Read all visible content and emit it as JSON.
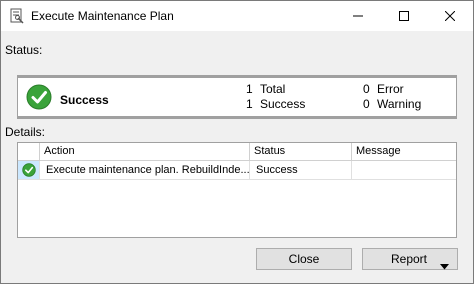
{
  "window": {
    "title": "Execute Maintenance Plan",
    "icon": "maintenance-plan-icon",
    "controls": [
      "minimize-icon",
      "maximize-icon",
      "close-icon"
    ]
  },
  "status": {
    "label": "Status:",
    "result": "Success",
    "result_icon": "check-icon",
    "stats": [
      {
        "count": "1",
        "label": "Total"
      },
      {
        "count": "1",
        "label": "Success"
      },
      {
        "count": "0",
        "label": "Error"
      },
      {
        "count": "0",
        "label": "Warning"
      }
    ]
  },
  "details": {
    "label": "Details:",
    "columns": [
      "Action",
      "Status",
      "Message"
    ],
    "rows": [
      {
        "icon": "check-icon",
        "action": "Execute maintenance plan. RebuildInde...",
        "status": "Success",
        "message": ""
      }
    ]
  },
  "buttons": {
    "close": "Close",
    "report": "Report"
  },
  "colors": {
    "success_green": "#3aa33a",
    "selection": "#cce8ff",
    "button_face": "#e1e1e1"
  }
}
